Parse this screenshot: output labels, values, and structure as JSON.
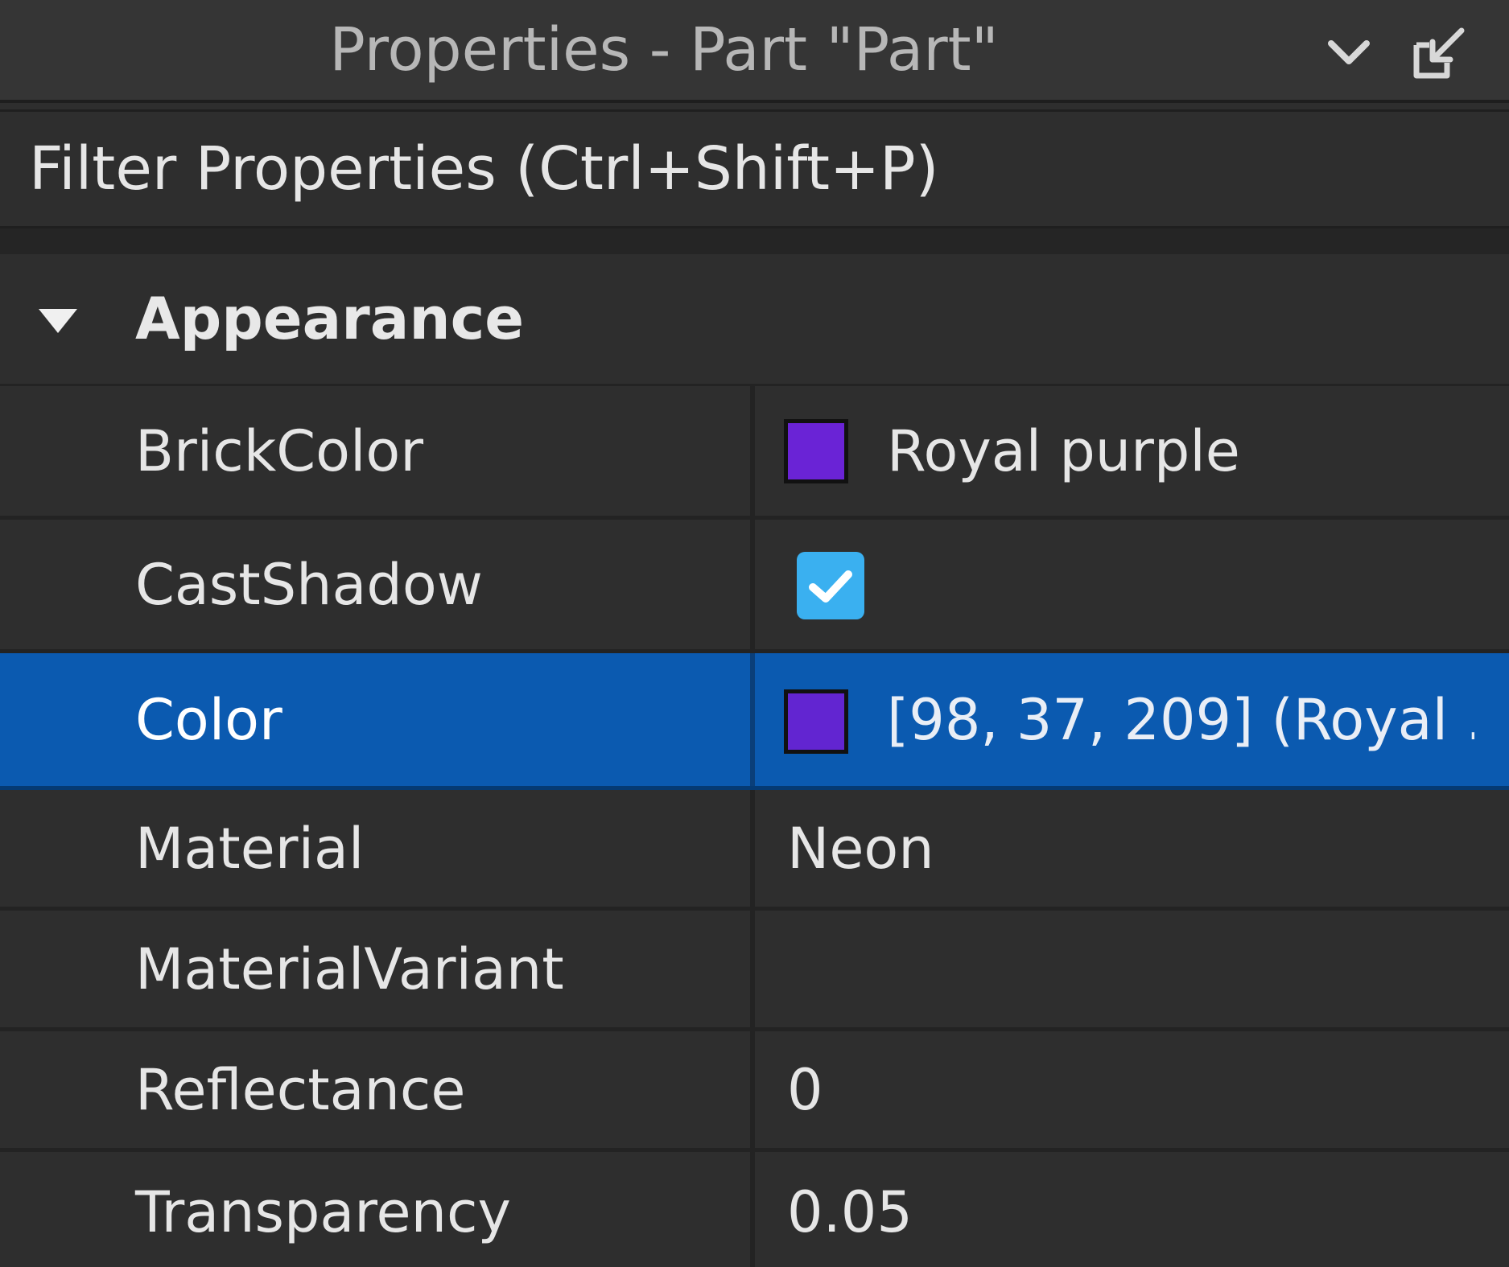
{
  "window": {
    "title": "Properties - Part \"Part\"",
    "icons": [
      "chevron-down-icon",
      "undock-icon"
    ]
  },
  "filter": {
    "placeholder": "Filter Properties (Ctrl+Shift+P)",
    "value": ""
  },
  "section": {
    "label": "Appearance",
    "expanded": true,
    "icon": "caret-down-icon"
  },
  "properties": [
    {
      "name": "BrickColor",
      "value": "Royal purple",
      "swatch": "#6a23d6",
      "type": "brickcolor"
    },
    {
      "name": "CastShadow",
      "value": true,
      "type": "checkbox"
    },
    {
      "name": "Color",
      "value": "[98, 37, 209] (Royal ...",
      "swatch": "#6225d1",
      "type": "color",
      "selected": true
    },
    {
      "name": "Material",
      "value": "Neon",
      "type": "enum"
    },
    {
      "name": "MaterialVariant",
      "value": "",
      "type": "string"
    },
    {
      "name": "Reflectance",
      "value": "0",
      "type": "number"
    },
    {
      "name": "Transparency",
      "value": "0.05",
      "type": "number"
    }
  ],
  "colors": {
    "background": "#2e2e2e",
    "selection": "#0b5ab0",
    "checkbox": "#3ab0f0",
    "text": "#e6e6e6"
  }
}
